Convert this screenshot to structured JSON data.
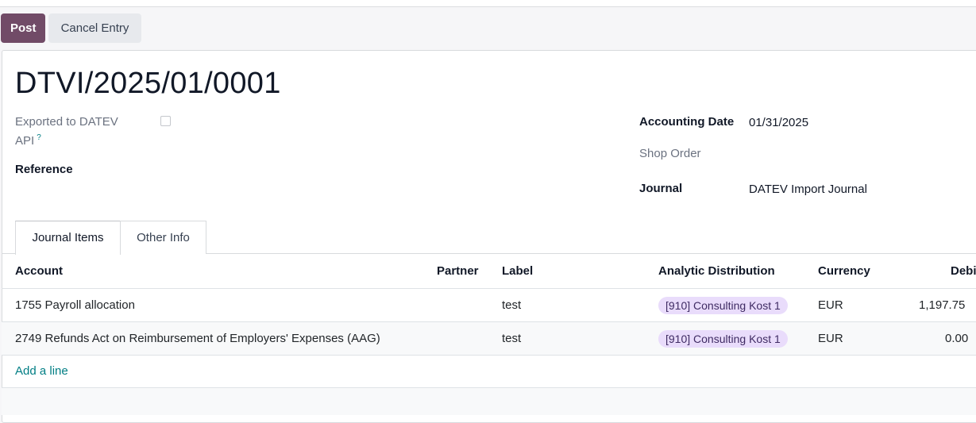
{
  "toolbar": {
    "post_label": "Post",
    "cancel_label": "Cancel Entry"
  },
  "record": {
    "title": "DTVI/2025/01/0001",
    "exported_label_line1": "Exported to DATEV",
    "exported_label_line2": "API",
    "exported_help": "?",
    "exported_checked": false,
    "reference_label": "Reference",
    "accounting_date_label": "Accounting Date",
    "accounting_date_value": "01/31/2025",
    "shop_order_label": "Shop Order",
    "journal_label": "Journal",
    "journal_value": "DATEV Import Journal"
  },
  "tabs": [
    {
      "label": "Journal Items",
      "active": true
    },
    {
      "label": "Other Info",
      "active": false
    }
  ],
  "table": {
    "headers": {
      "account": "Account",
      "partner": "Partner",
      "label": "Label",
      "analytic": "Analytic Distribution",
      "currency": "Currency",
      "debit": "Debi"
    },
    "rows": [
      {
        "account": "1755 Payroll allocation",
        "partner": "",
        "label": "test",
        "analytic": "[910] Consulting Kost 1",
        "currency": "EUR",
        "debit": "1,197.75"
      },
      {
        "account": "2749 Refunds Act on Reimbursement of Employers' Expenses (AAG)",
        "partner": "",
        "label": "test",
        "analytic": "[910] Consulting Kost 1",
        "currency": "EUR",
        "debit": "0.00"
      }
    ],
    "add_line": "Add a line"
  },
  "colors": {
    "primary": "#714b67",
    "link": "#017e84",
    "tag_bg": "#e9dcfb"
  }
}
